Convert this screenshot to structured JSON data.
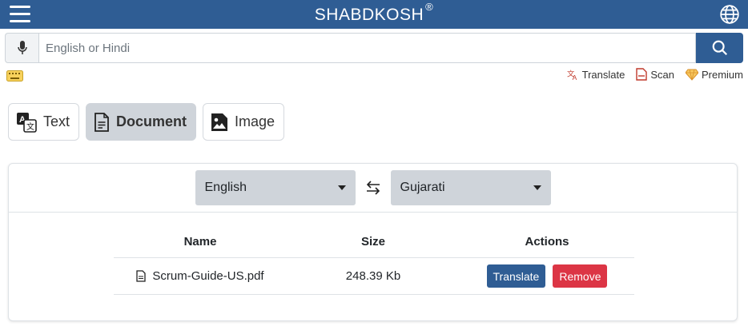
{
  "header": {
    "brand": "SHABDKOSH",
    "brand_mark": "®",
    "menu_icon": "hamburger-icon",
    "globe_icon": "globe-icon"
  },
  "search": {
    "placeholder": "English or Hindi",
    "value": "",
    "mic_icon": "microphone-icon",
    "search_icon": "search-icon"
  },
  "toolbar": {
    "keyboard_icon": "keyboard-icon"
  },
  "quicklinks": [
    {
      "label": "Translate",
      "icon": "translate-icon"
    },
    {
      "label": "Scan",
      "icon": "scan-document-icon"
    },
    {
      "label": "Premium",
      "icon": "diamond-icon"
    }
  ],
  "modes": [
    {
      "label": "Text",
      "icon": "text-translate-icon",
      "active": false
    },
    {
      "label": "Document",
      "icon": "document-icon",
      "active": true
    },
    {
      "label": "Image",
      "icon": "image-icon",
      "active": false
    }
  ],
  "languages": {
    "source": "English",
    "target": "Gujarati",
    "swap_icon": "swap-arrows-icon"
  },
  "files_table": {
    "headers": {
      "name": "Name",
      "size": "Size",
      "actions": "Actions"
    },
    "rows": [
      {
        "name": "Scrum-Guide-US.pdf",
        "size": "248.39 Kb",
        "translate_label": "Translate",
        "remove_label": "Remove",
        "icon": "file-icon"
      }
    ]
  },
  "colors": {
    "primary": "#2f5d94",
    "danger": "#dc3545",
    "active_mode": "#cfd4da",
    "premium": "#e8a33d",
    "quicklink_icon": "#c0392b"
  }
}
